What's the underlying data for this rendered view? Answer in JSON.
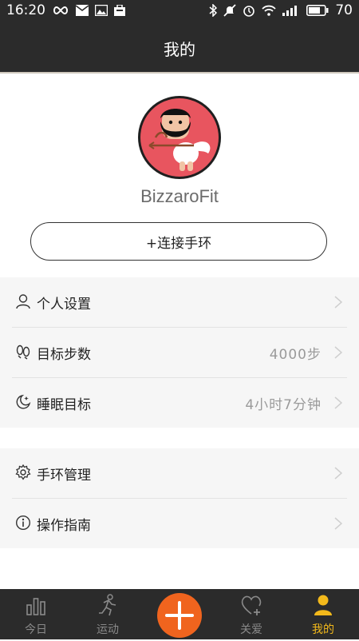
{
  "status_bar": {
    "time": "16:20",
    "battery": "70",
    "left_icons": [
      "infinity-icon",
      "mail-icon",
      "image-icon",
      "briefcase-icon"
    ],
    "right_icons": [
      "bluetooth-icon",
      "mute-icon",
      "alarm-icon",
      "wifi-icon",
      "signal-icon",
      "battery-icon"
    ]
  },
  "header": {
    "title": "我的"
  },
  "profile": {
    "username": "BizzaroFit",
    "connect_button": "+连接手环"
  },
  "settings_group_1": [
    {
      "label": "个人设置",
      "value": "",
      "icon": "person-icon"
    },
    {
      "label": "目标步数",
      "value": "4000步",
      "icon": "footprints-icon"
    },
    {
      "label": "睡眠目标",
      "value": "4小时7分钟",
      "icon": "moon-icon"
    }
  ],
  "settings_group_2": [
    {
      "label": "手环管理",
      "value": "",
      "icon": "gear-icon"
    },
    {
      "label": "操作指南",
      "value": "",
      "icon": "info-icon"
    }
  ],
  "tab_bar": {
    "tabs": [
      {
        "label": "今日",
        "icon": "bar-chart-icon"
      },
      {
        "label": "运动",
        "icon": "runner-icon"
      },
      {
        "label": "",
        "icon": "plus-icon"
      },
      {
        "label": "关爱",
        "icon": "heart-plus-icon"
      },
      {
        "label": "我的",
        "icon": "user-icon"
      }
    ],
    "active": "我的",
    "colors": {
      "active": "#f3b91b",
      "inactive": "#8a8a8a",
      "plus": "#f0641e"
    }
  }
}
